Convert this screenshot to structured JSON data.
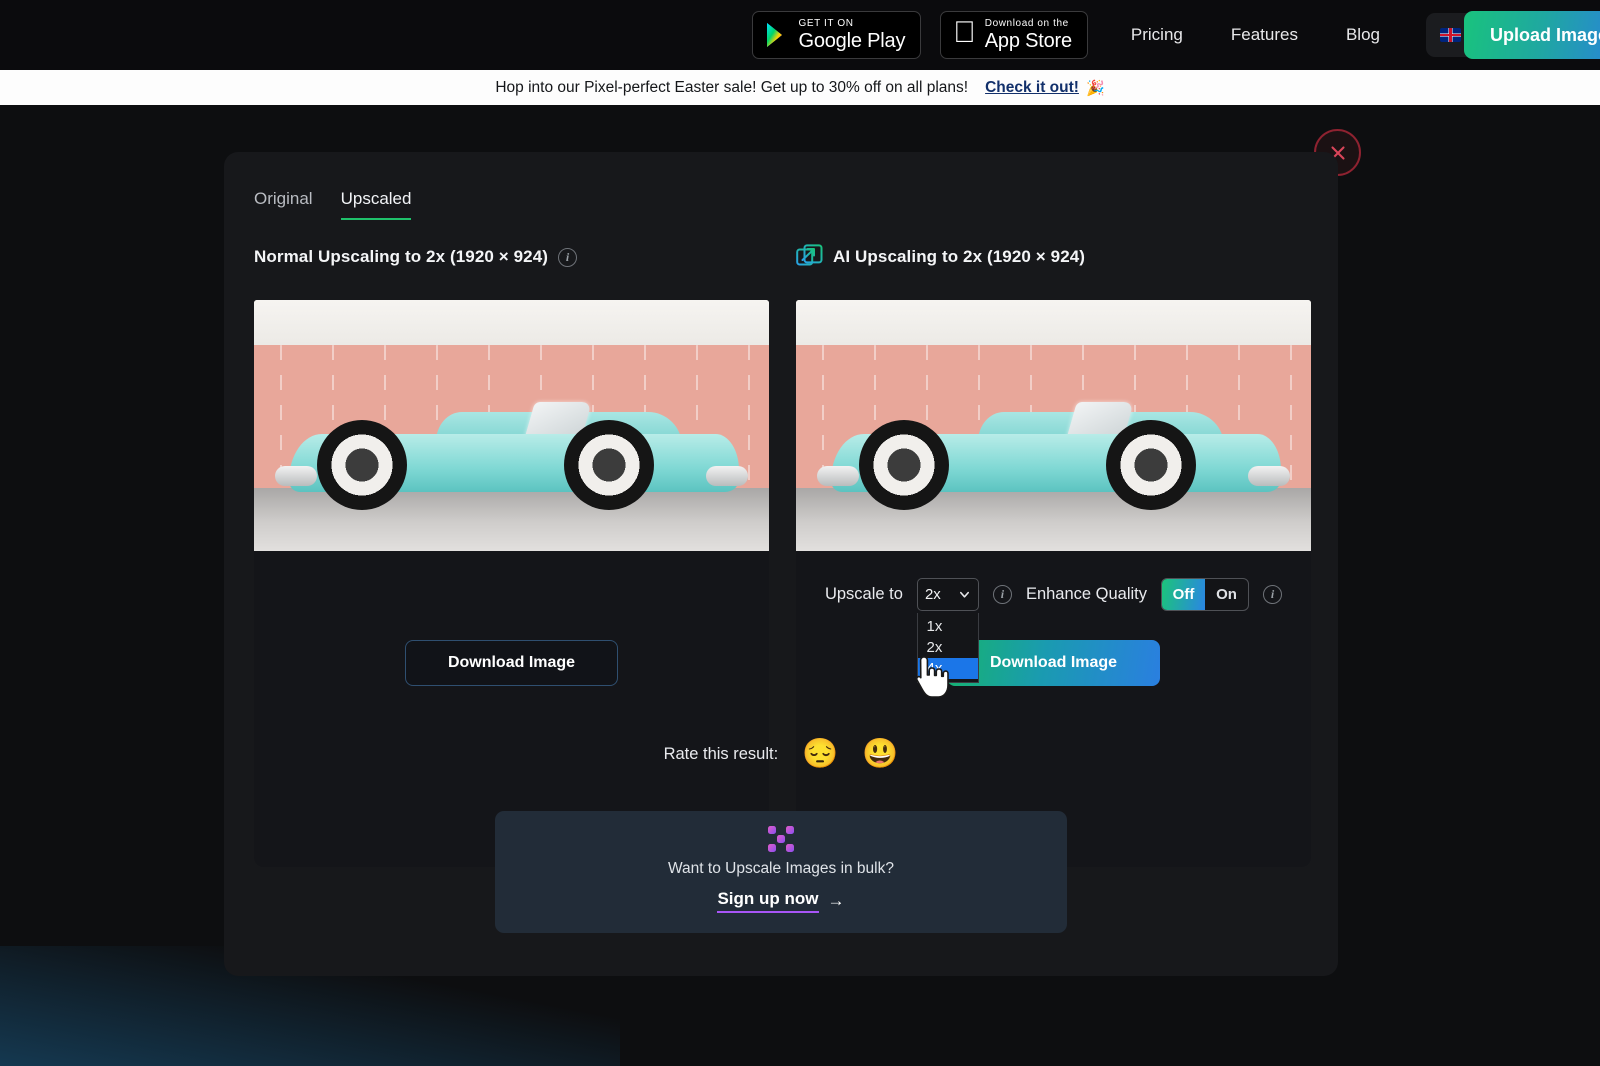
{
  "topnav": {
    "google_play": {
      "small": "GET IT ON",
      "big": "Google Play"
    },
    "app_store": {
      "small": "Download on the",
      "big": "App Store"
    },
    "links": [
      {
        "label": "Pricing"
      },
      {
        "label": "Features"
      },
      {
        "label": "Blog"
      }
    ],
    "language": {
      "value": "English",
      "flag": "uk-flag-icon",
      "chevron": "chevron-down-icon"
    },
    "upload_button": "Upload Image"
  },
  "promo": {
    "text": "Hop into our Pixel-perfect Easter sale! Get up to 30% off on all plans!",
    "link": "Check it out!",
    "emoji": "🎉"
  },
  "modal": {
    "close_icon": "close-icon",
    "tabs": [
      {
        "label": "Original",
        "active": false
      },
      {
        "label": "Upscaled",
        "active": true
      }
    ],
    "left": {
      "title": "Normal Upscaling to 2x (1920 × 924)",
      "info_icon": "info-icon",
      "download_label": "Download Image"
    },
    "right": {
      "icon": "ai-upscale-icon",
      "title": "AI Upscaling to 2x (1920 × 924)",
      "upscale_label": "Upscale to",
      "upscale_value": "2x",
      "upscale_options": [
        "1x",
        "2x",
        "4x"
      ],
      "upscale_highlighted": "4x",
      "upscale_info_icon": "info-icon",
      "enhance_label": "Enhance Quality",
      "enhance_options": [
        "Off",
        "On"
      ],
      "enhance_value": "Off",
      "enhance_info_icon": "info-icon",
      "download_label": "Download Image"
    },
    "rating": {
      "label": "Rate this result:",
      "negative_emoji": "😔",
      "positive_emoji": "😃"
    },
    "bulk": {
      "icon": "bulk-upscale-icon",
      "text": "Want to Upscale Images in bulk?",
      "cta": "Sign up now",
      "arrow": "→"
    }
  },
  "colors": {
    "accent_green": "#1fc16b",
    "accent_blue": "#2a7fe0",
    "highlight_blue": "#1b76e8",
    "close_red": "#8e2230",
    "purple": "#a855f7"
  }
}
